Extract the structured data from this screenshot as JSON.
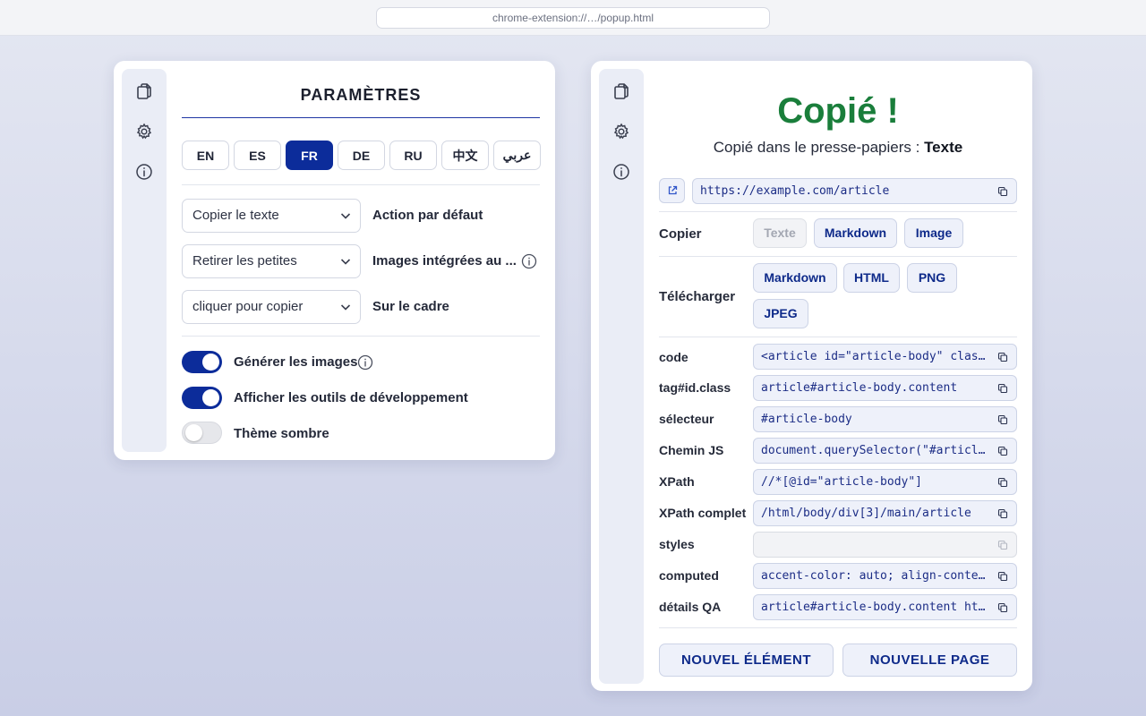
{
  "browser": {
    "url": "chrome-extension://…/popup.html"
  },
  "settings": {
    "title": "PARAMÈTRES",
    "languages": [
      {
        "code": "EN",
        "active": false
      },
      {
        "code": "ES",
        "active": false
      },
      {
        "code": "FR",
        "active": true
      },
      {
        "code": "DE",
        "active": false
      },
      {
        "code": "RU",
        "active": false
      },
      {
        "code": "中文",
        "active": false
      },
      {
        "code": "عربي",
        "active": false
      }
    ],
    "options": [
      {
        "value": "Copier le texte",
        "label": "Action par défaut"
      },
      {
        "value": "Retirer les petites",
        "label": "Images intégrées au ..."
      },
      {
        "value": "cliquer pour copier",
        "label": "Sur le cadre"
      }
    ],
    "toggles": [
      {
        "label": "Générer les images",
        "on": true
      },
      {
        "label": "Afficher les outils de développement",
        "on": true
      },
      {
        "label": "Thème sombre",
        "on": false
      }
    ]
  },
  "result": {
    "title": "Copié !",
    "subtitle_prefix": "Copié dans le presse-papiers : ",
    "subtitle_value": "Texte",
    "url": "https://example.com/article",
    "copy_label": "Copier",
    "copy_buttons": [
      {
        "label": "Texte",
        "disabled": true
      },
      {
        "label": "Markdown",
        "disabled": false
      },
      {
        "label": "Image",
        "disabled": false
      }
    ],
    "download_label": "Télécharger",
    "download_buttons": [
      "Markdown",
      "HTML",
      "PNG",
      "JPEG"
    ],
    "details": [
      {
        "label": "code",
        "value": "<article id=\"article-body\" class=\"content\">"
      },
      {
        "label": "tag#id.class",
        "value": "article#article-body.content"
      },
      {
        "label": "sélecteur",
        "value": "#article-body"
      },
      {
        "label": "Chemin JS",
        "value": "document.querySelector(\"#article-body\")"
      },
      {
        "label": "XPath",
        "value": "//*[@id=\"article-body\"]"
      },
      {
        "label": "XPath complet",
        "value": "/html/body/div[3]/main/article"
      },
      {
        "label": "styles",
        "value": ""
      },
      {
        "label": "computed",
        "value": "accent-color: auto; align-content: normal;"
      },
      {
        "label": "détails QA",
        "value": "article#article-body.content https://example.com/article"
      }
    ],
    "new_element_label": "NOUVEL ÉLÉMENT",
    "new_page_label": "NOUVELLE PAGE"
  },
  "icons": {
    "rail": [
      "copy-icon",
      "gear-icon",
      "info-icon"
    ],
    "accent_color": "#0c2c9a",
    "success_color": "#1a7e3b"
  }
}
